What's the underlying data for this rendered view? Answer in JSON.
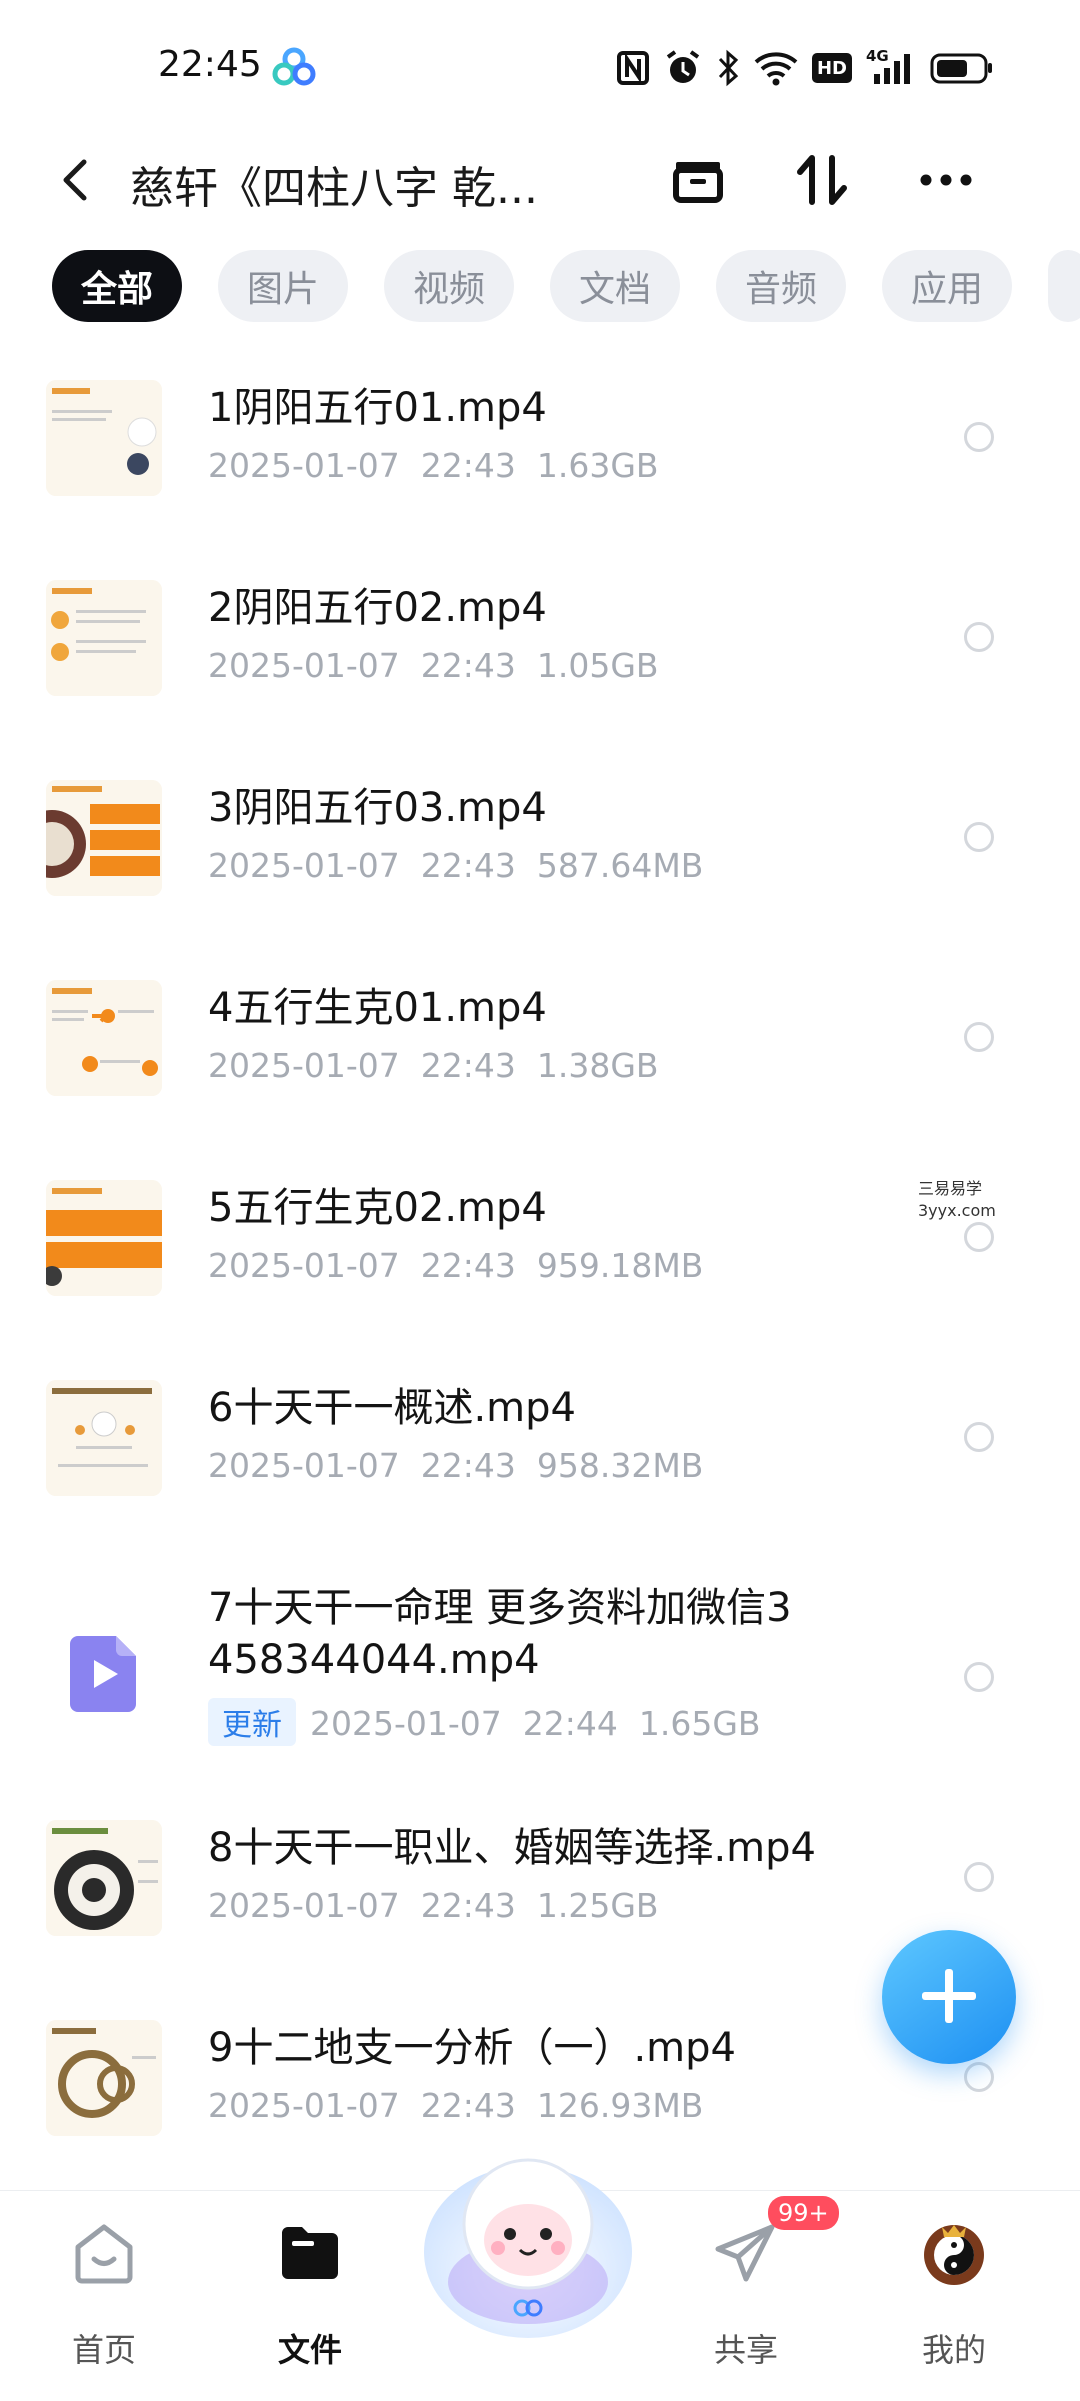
{
  "status_bar": {
    "time": "22:45",
    "network": "4G",
    "hd": "HD"
  },
  "header": {
    "title": "慈轩《四柱八字 乾...",
    "back_icon": "back-arrow-icon",
    "actions": [
      "select-box-icon",
      "sort-icon",
      "more-icon"
    ]
  },
  "filters": [
    "全部",
    "图片",
    "视频",
    "文档",
    "音频",
    "应用"
  ],
  "files": [
    {
      "name": "1阴阳五行01.mp4",
      "date": "2025-01-07",
      "time": "22:43",
      "size": "1.63GB",
      "thumb": "video-thumbnail"
    },
    {
      "name": "2阴阳五行02.mp4",
      "date": "2025-01-07",
      "time": "22:43",
      "size": "1.05GB",
      "thumb": "video-thumbnail"
    },
    {
      "name": "3阴阳五行03.mp4",
      "date": "2025-01-07",
      "time": "22:43",
      "size": "587.64MB",
      "thumb": "video-thumbnail"
    },
    {
      "name": "4五行生克01.mp4",
      "date": "2025-01-07",
      "time": "22:43",
      "size": "1.38GB",
      "thumb": "video-thumbnail"
    },
    {
      "name": "5五行生克02.mp4",
      "date": "2025-01-07",
      "time": "22:43",
      "size": "959.18MB",
      "thumb": "video-thumbnail"
    },
    {
      "name": "6十天干一概述.mp4",
      "date": "2025-01-07",
      "time": "22:43",
      "size": "958.32MB",
      "thumb": "video-thumbnail"
    },
    {
      "name": "7十天干一命理 更多资料加微信3458344044.mp4",
      "badge": "更新",
      "date": "2025-01-07",
      "time": "22:44",
      "size": "1.65GB",
      "thumb": "video-file-icon"
    },
    {
      "name": "8十天干一职业、婚姻等选择.mp4",
      "date": "2025-01-07",
      "time": "22:43",
      "size": "1.25GB",
      "thumb": "video-thumbnail"
    },
    {
      "name": "9十二地支一分析（一）.mp4",
      "date": "2025-01-07",
      "time": "22:43",
      "size": "126.93MB",
      "thumb": "video-thumbnail"
    }
  ],
  "watermark": {
    "line1": "三易易学",
    "line2": "3yyx.com"
  },
  "tabs": [
    {
      "label": "首页",
      "icon": "home-icon"
    },
    {
      "label": "文件",
      "icon": "folder-icon"
    },
    {
      "label": "共享",
      "icon": "share-plane-icon",
      "badge": "99+"
    },
    {
      "label": "我的",
      "icon": "avatar-icon"
    }
  ],
  "colors": {
    "accent": "#1d8ff2",
    "chip_active": "#0d0f14",
    "badge_red": "#ff4d5e"
  }
}
